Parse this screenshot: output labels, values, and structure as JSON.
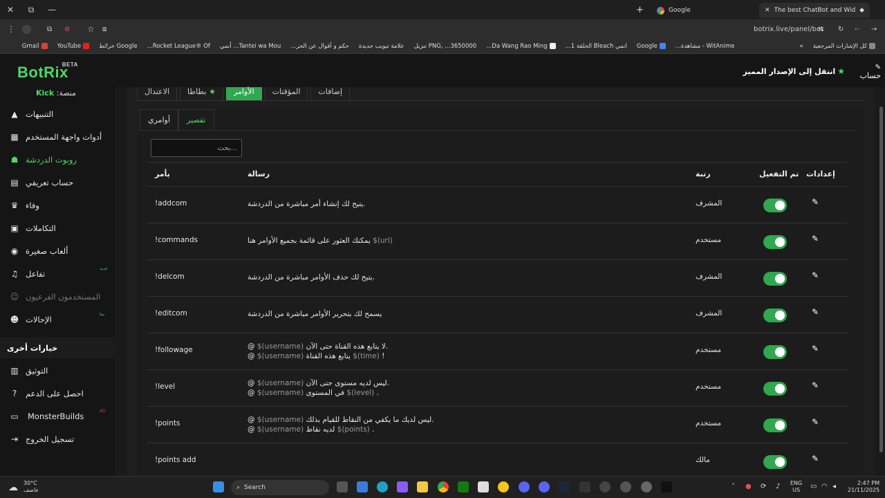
{
  "browser": {
    "tabs": [
      {
        "title": "Google"
      },
      {
        "title": "The best ChatBot and Widgets"
      }
    ],
    "address": "botrix.live/panel/bot",
    "bookmarks": [
      {
        "label": "كل الإشارات المرجعية"
      },
      {
        "label": "WitAnime - مشاهدة..."
      },
      {
        "label": "Google"
      },
      {
        "label": "انمي Bleach الحلقة 1..."
      },
      {
        "label": "Da Wang Rao Ming..."
      },
      {
        "label": "PNG, ...3650000 تنزيل"
      },
      {
        "label": "علامة تبويب جديدة"
      },
      {
        "label": "حكم و أقوال عن الحر..."
      },
      {
        "label": "Tantei wa Mou... أنمي"
      },
      {
        "label": "Rocket League® Of..."
      },
      {
        "label": "Google خرائط"
      },
      {
        "label": "YouTube"
      },
      {
        "label": "Gmail"
      }
    ]
  },
  "header": {
    "logo": "BotRix",
    "logo_badge": "BETA",
    "premium_label": "انتقل إلى الإصدار المميز",
    "account_label": "حساب"
  },
  "sidebar": {
    "platform_prefix": "منصة: ",
    "platform_name": "Kick",
    "items": [
      {
        "label": "التنبيهات",
        "icon": "warning-icon"
      },
      {
        "label": "أدوات واجهة المستخدم",
        "icon": "widgets-icon"
      },
      {
        "label": "روبوت الدردشة",
        "icon": "robot-icon"
      },
      {
        "label": "حساب تعريفي",
        "icon": "id-card-icon"
      },
      {
        "label": "وفاء",
        "icon": "trophy-icon"
      },
      {
        "label": "التكاملات",
        "icon": "integrations-icon"
      },
      {
        "label": "ألعاب صغيرة",
        "icon": "gamepad-icon"
      },
      {
        "label": "تفاعل",
        "icon": "music-icon",
        "badge": "جديد"
      },
      {
        "label": "المستخدمون الفرعيون",
        "icon": "users-icon"
      },
      {
        "label": "الإحالات",
        "icon": "referral-icon",
        "badge": "بيتا"
      }
    ],
    "other_header": "خيارات أخرى",
    "other_items": [
      {
        "label": "التوثيق",
        "icon": "document-icon"
      },
      {
        "label": "احصل على الدعم",
        "icon": "help-icon"
      },
      {
        "label": "MonsterBuilds",
        "icon": "laptop-icon",
        "badge": "AD"
      },
      {
        "label": "تسجيل الخروج",
        "icon": "logout-icon"
      }
    ]
  },
  "main": {
    "top_tabs": [
      "الاعتدال",
      "بطاطا",
      "الأوامر",
      "المؤقتات",
      "إضافات"
    ],
    "sub_tabs": [
      "أوامري",
      "تقصير"
    ],
    "search_placeholder": "...بحث",
    "columns": {
      "command": "يأمر",
      "message": "رسالة",
      "rank": "رتبة",
      "enabled": "تم التفعيل",
      "settings": "إعدادات"
    },
    "rows": [
      {
        "command": "!addcom",
        "message": [
          [
            {
              "t": "يتيح لك إنشاء أمر مباشرة من الدردشة."
            }
          ]
        ],
        "rank": "المشرف",
        "enabled": true
      },
      {
        "command": "!commands",
        "message": [
          [
            {
              "t": "يمكنك العثور على قائمة بجميع الأوامر هنا"
            },
            {
              "t": " $(url)",
              "v": true
            }
          ]
        ],
        "rank": "مستخدم",
        "enabled": true
      },
      {
        "command": "!delcom",
        "message": [
          [
            {
              "t": "يتيح لك حذف الأوامر مباشرة من الدردشة."
            }
          ]
        ],
        "rank": "المشرف",
        "enabled": true
      },
      {
        "command": "!editcom",
        "message": [
          [
            {
              "t": "يسمح لك بتحرير الأوامر مباشرة من الدردشة"
            }
          ]
        ],
        "rank": "المشرف",
        "enabled": true
      },
      {
        "command": "!followage",
        "message": [
          [
            {
              "t": "@ "
            },
            {
              "t": "$(username) ",
              "v": true
            },
            {
              "t": "لا يتابع هذه القناة حتى الآن."
            }
          ],
          [
            {
              "t": "@ "
            },
            {
              "t": "$(username) ",
              "v": true
            },
            {
              "t": "يتابع هذه القناة "
            },
            {
              "t": "$(time)",
              "v": true
            },
            {
              "t": " !"
            }
          ]
        ],
        "rank": "مستخدم",
        "enabled": true
      },
      {
        "command": "!level",
        "message": [
          [
            {
              "t": "@ "
            },
            {
              "t": "$(username) ",
              "v": true
            },
            {
              "t": "ليس لديه مستوى حتى الآن."
            }
          ],
          [
            {
              "t": "@ "
            },
            {
              "t": "$(username) ",
              "v": true
            },
            {
              "t": "في المستوى "
            },
            {
              "t": "$(level)",
              "v": true
            },
            {
              "t": " ."
            }
          ]
        ],
        "rank": "مستخدم",
        "enabled": true
      },
      {
        "command": "!points",
        "message": [
          [
            {
              "t": "@ "
            },
            {
              "t": "$(username) ",
              "v": true
            },
            {
              "t": "ليس لديك ما يكفي من النقاط للقيام بذلك."
            }
          ],
          [
            {
              "t": "@ "
            },
            {
              "t": "$(username) ",
              "v": true
            },
            {
              "t": "لديه نقاط "
            },
            {
              "t": "$(points)",
              "v": true
            },
            {
              "t": " ."
            }
          ]
        ],
        "rank": "مستخدم",
        "enabled": true
      },
      {
        "command": "!points add",
        "message": [],
        "rank": "مالك",
        "enabled": true
      }
    ]
  },
  "taskbar": {
    "weather_temp": "30°C",
    "weather_desc": "عاصف",
    "search_label": "Search",
    "lang_top": "ENG",
    "lang_bottom": "US",
    "time": "2:47 PM",
    "date": "21/11/2025"
  }
}
